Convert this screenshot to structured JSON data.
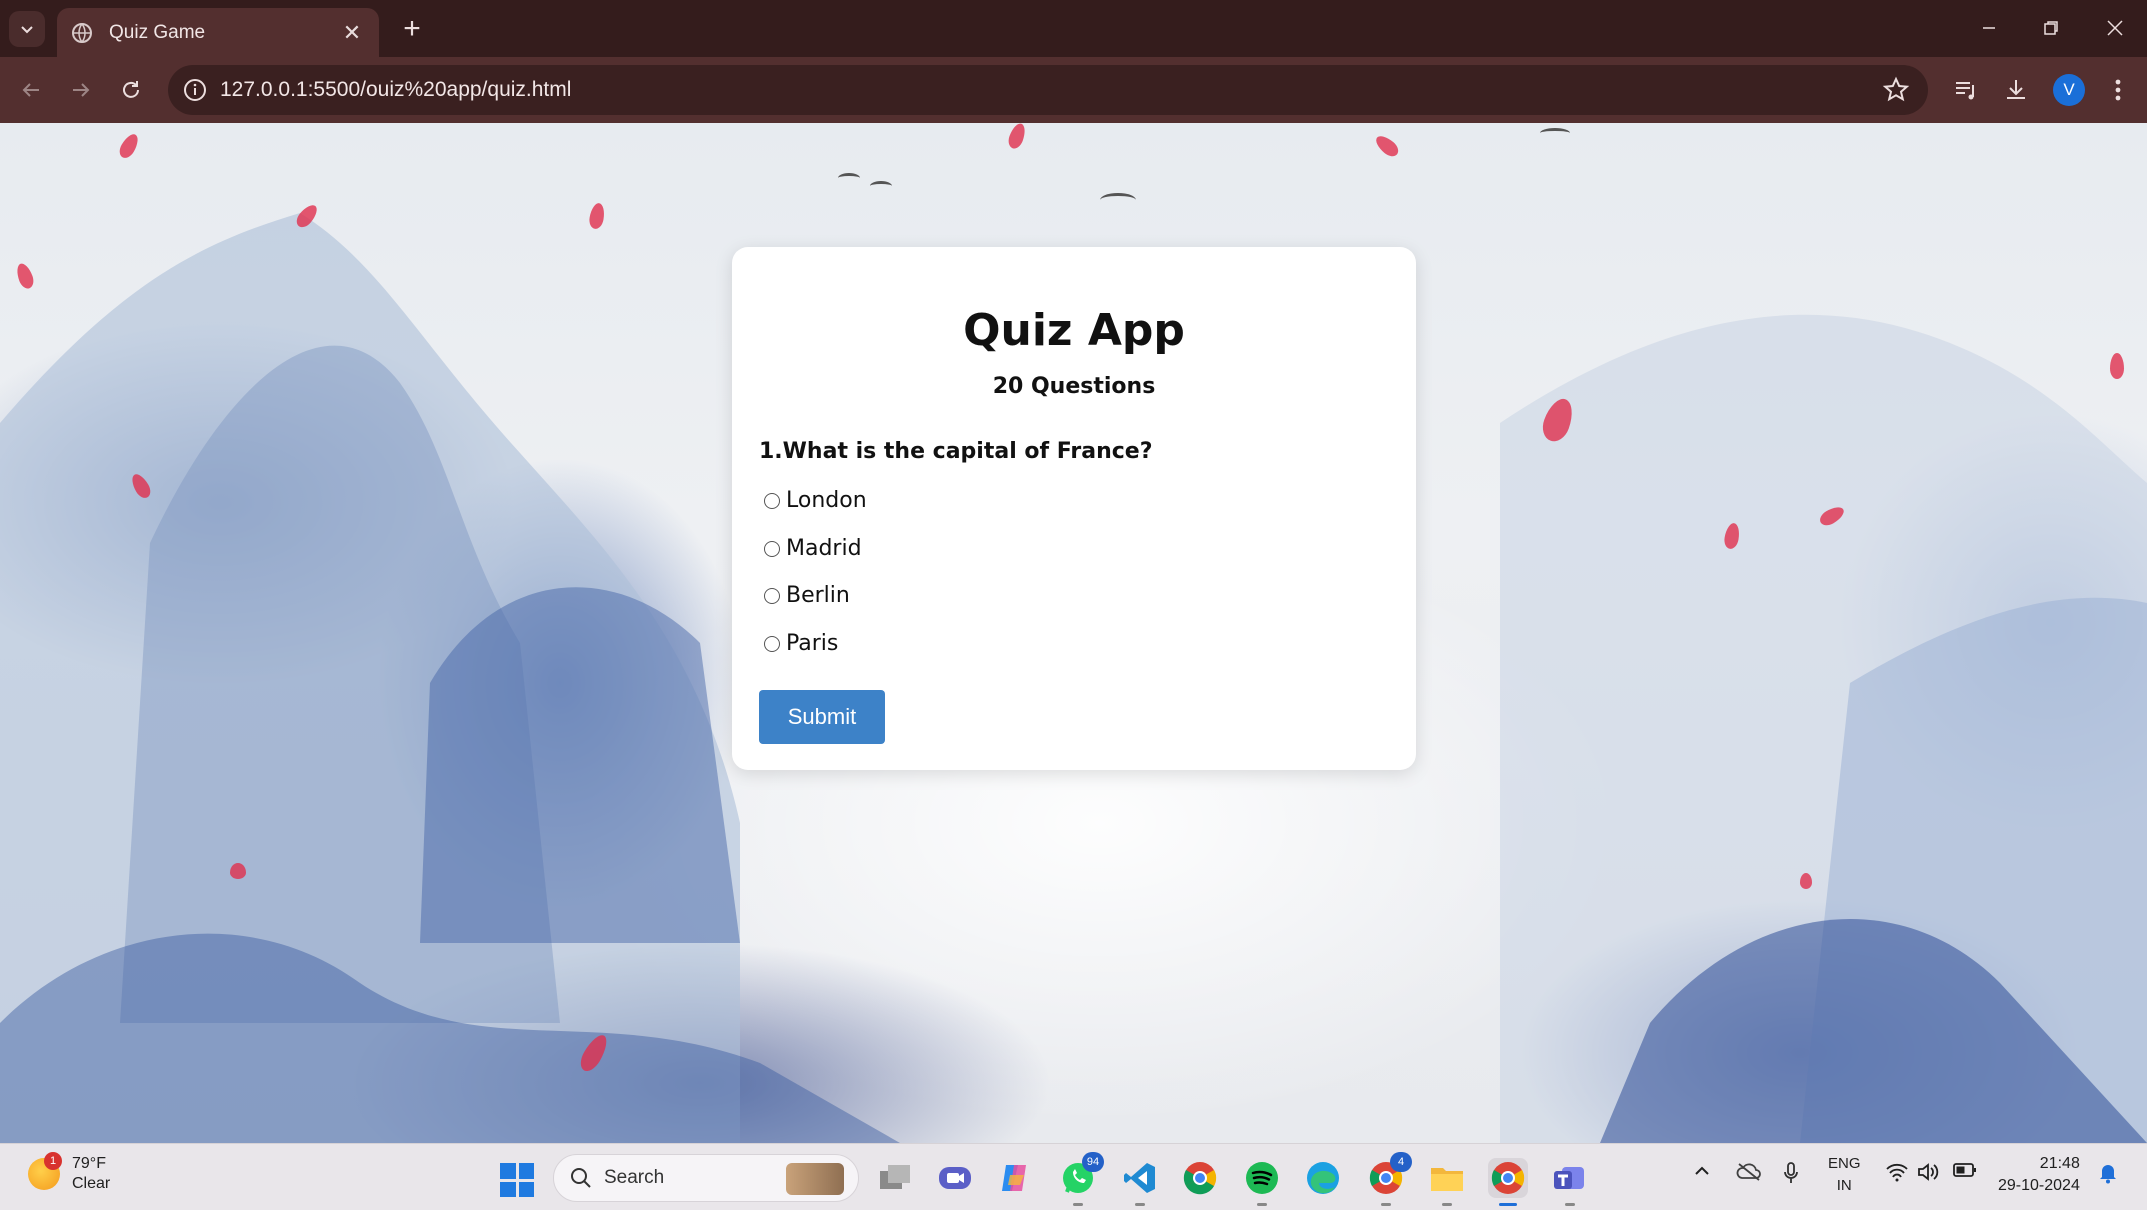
{
  "browser": {
    "tab_title": "Quiz Game",
    "url": "127.0.0.1:5500/ouiz%20app/quiz.html",
    "profile_initial": "V"
  },
  "quiz": {
    "title": "Quiz App",
    "subtitle": "20 Questions",
    "question": "1.What is the capital of France?",
    "options": [
      "London",
      "Madrid",
      "Berlin",
      "Paris"
    ],
    "submit_label": "Submit"
  },
  "taskbar": {
    "weather_temp": "79°F",
    "weather_condition": "Clear",
    "weather_badge": "1",
    "search_label": "Search",
    "whatsapp_badge": "94",
    "chrome_badge": "4",
    "lang_line1": "ENG",
    "lang_line2": "IN",
    "time": "21:48",
    "date": "29-10-2024"
  },
  "colors": {
    "submit_button": "#3d82c8",
    "chrome_frame": "#532f2f",
    "taskbar": "#e9e6ea"
  }
}
